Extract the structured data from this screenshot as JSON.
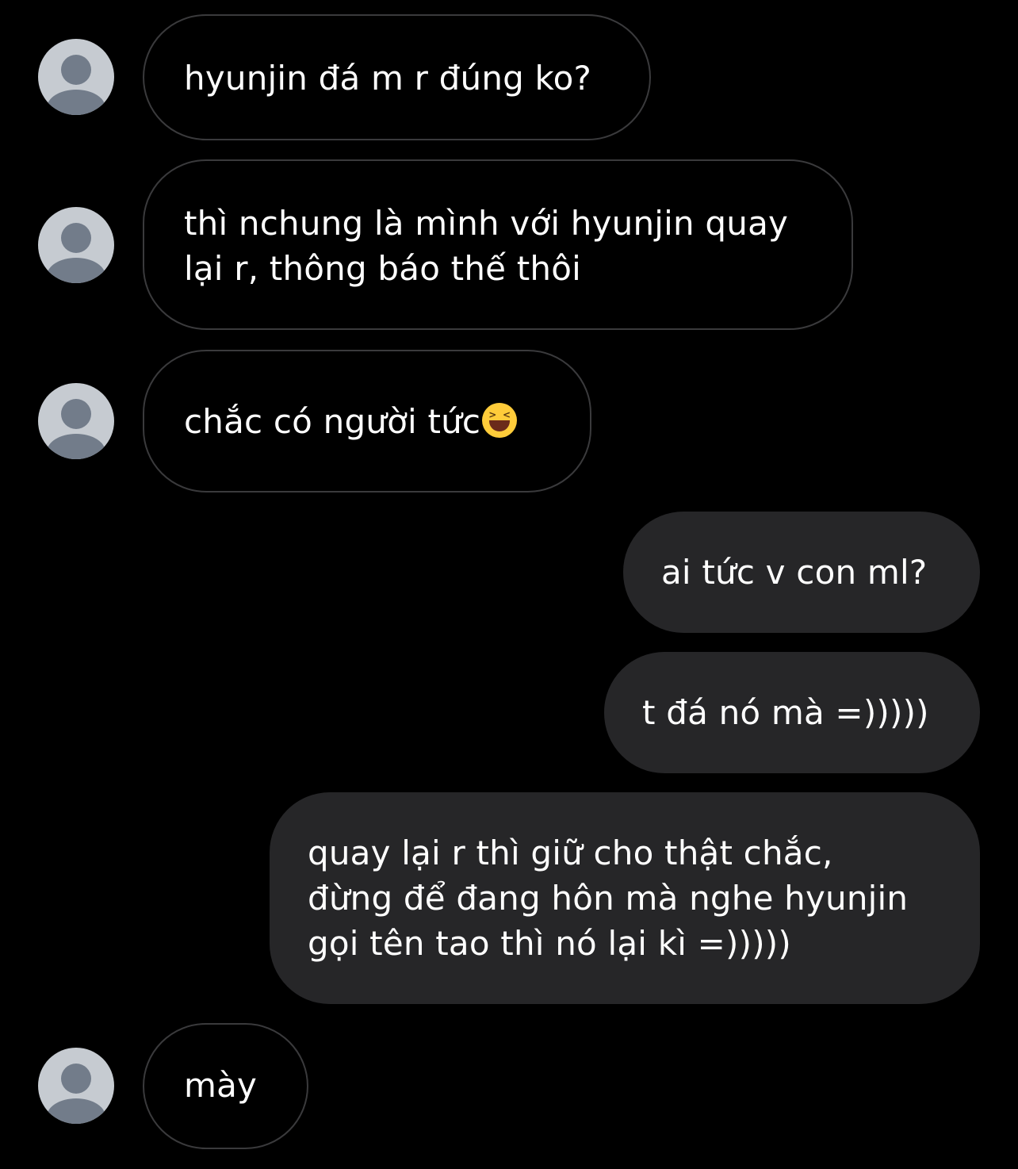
{
  "messages": [
    {
      "direction": "incoming",
      "lines": [
        "hyunjin đá m r đúng ko?"
      ]
    },
    {
      "direction": "incoming",
      "lines": [
        "thì nchung là mình với hyunjin quay",
        "lại r, thông báo thế thôi"
      ]
    },
    {
      "direction": "incoming",
      "lines": [
        "chắc có người tức"
      ],
      "emoji": "grinning-squinting-face-emoji"
    },
    {
      "direction": "outgoing",
      "lines": [
        "ai tức v con ml?"
      ]
    },
    {
      "direction": "outgoing",
      "lines": [
        "t đá nó mà =)))))"
      ]
    },
    {
      "direction": "outgoing",
      "lines": [
        "quay lại r thì giữ cho thật chắc,",
        "đừng để đang hôn mà nghe hyunjin",
        "gọi tên tao thì nó lại kì =)))))"
      ]
    },
    {
      "direction": "incoming",
      "lines": [
        "mày"
      ]
    }
  ],
  "colors": {
    "background": "#000000",
    "outgoing_bubble": "#262628",
    "incoming_border": "#3a3a3c",
    "avatar_bg": "#c6cbd1",
    "avatar_fg": "#727c8a"
  },
  "icons": {
    "avatar": "default-user-avatar-icon"
  }
}
